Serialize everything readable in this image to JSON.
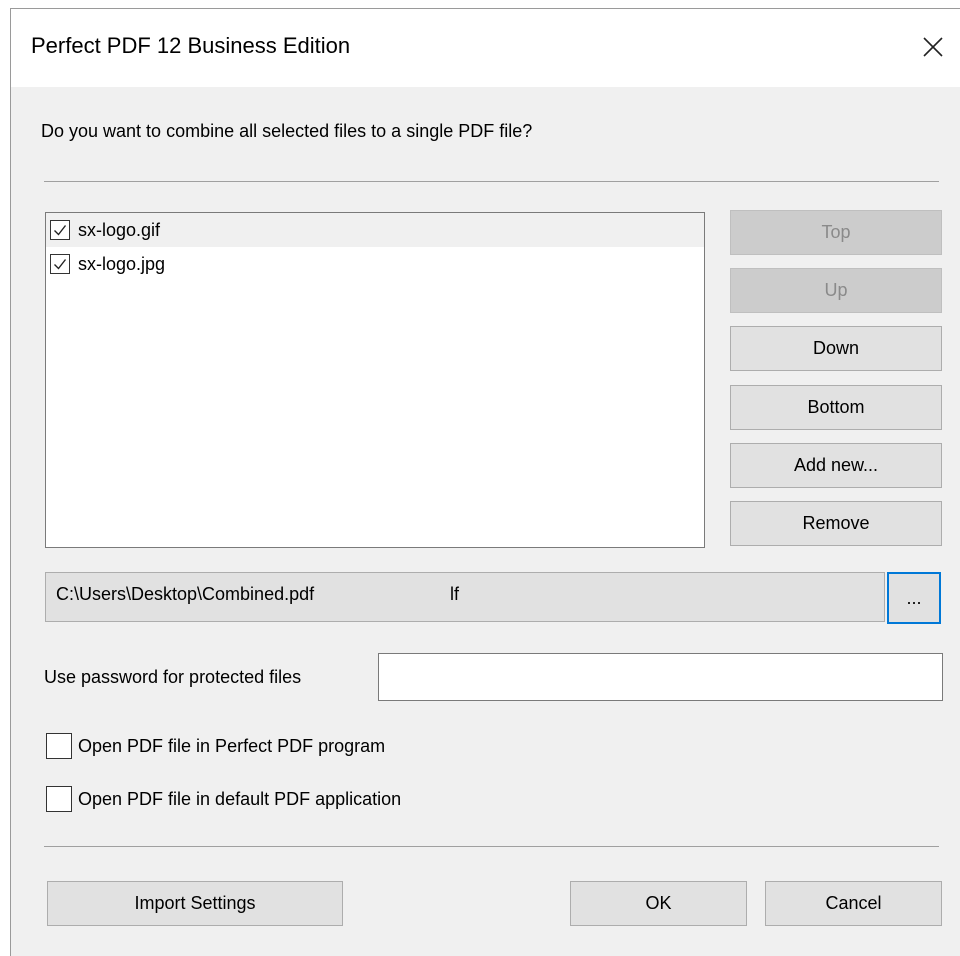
{
  "window": {
    "title": "Perfect PDF 12 Business Edition",
    "close_icon": "close-icon"
  },
  "prompt": "Do you want to combine all selected files to a single PDF file?",
  "files": [
    {
      "name": "sx-logo.gif",
      "checked": true,
      "selected": true
    },
    {
      "name": "sx-logo.jpg",
      "checked": true,
      "selected": false
    }
  ],
  "order_buttons": {
    "top": "Top",
    "up": "Up",
    "down": "Down",
    "bottom": "Bottom",
    "add_new": "Add new...",
    "remove": "Remove"
  },
  "output": {
    "path": "C:\\Users\\Desktop\\Combined.pdf",
    "path_suffix": "lf",
    "browse_label": "..."
  },
  "password": {
    "label": "Use password for protected files",
    "value": ""
  },
  "options": {
    "open_in_perfect_pdf": "Open PDF file in Perfect PDF program",
    "open_in_default": "Open PDF file in default PDF application"
  },
  "footer": {
    "import_settings": "Import Settings",
    "ok": "OK",
    "cancel": "Cancel"
  },
  "colors": {
    "focus_border": "#0078d7",
    "dialog_bg": "#f0f0f0",
    "button_bg": "#e1e1e1",
    "disabled_bg": "#cccccc"
  }
}
